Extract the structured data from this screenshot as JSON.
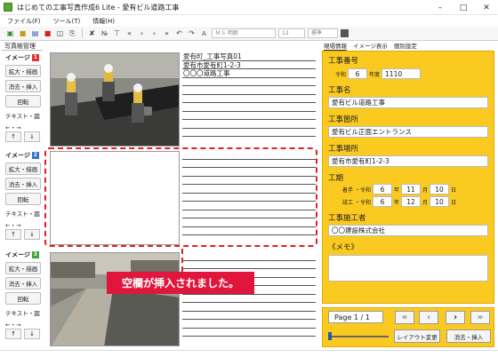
{
  "window": {
    "title": "はじめての工事写真作成6 Lite - 愛有ビル道路工事"
  },
  "menu": [
    "ファイル(F)",
    "ツール(T)",
    "情報(H)"
  ],
  "toolbar": {
    "font": "ＭＳ 明朝",
    "size": "12",
    "style": "標準"
  },
  "left": {
    "tab": "写真帳管理",
    "groups": [
      {
        "label": "イメージ",
        "num": "1",
        "badge": "#e03030"
      },
      {
        "label": "イメージ",
        "num": "2",
        "badge": "#2f74c8"
      },
      {
        "label": "イメージ",
        "num": "3",
        "badge": "#3aa33a"
      }
    ],
    "buttons": {
      "enlarge": "拡大・描画",
      "erase": "消去・挿入",
      "rotate": "回転",
      "text": "テキスト・図",
      "arrows": "←・→"
    }
  },
  "photos": [
    {
      "lines": [
        "愛有町_工事写真01",
        "愛有市愛有町1-2-3",
        "〇〇〇道路工事"
      ]
    },
    {
      "lines": []
    },
    {
      "lines": []
    }
  ],
  "notice": "空欄が挿入されました。",
  "right": {
    "tabs": [
      "現場情報",
      "イメージ表示",
      "個別設定"
    ],
    "work_no": {
      "label": "工事番号",
      "era": "令和",
      "year": "6",
      "year_unit": "年度",
      "code": "1110"
    },
    "work_name": {
      "label": "工事名",
      "value": "愛有ビル道路工事"
    },
    "work_place": {
      "label": "工事箇所",
      "value": "愛有ビル正面エントランス"
    },
    "work_site": {
      "label": "工事場所",
      "value": "愛有市愛有町1-2-3"
    },
    "period": {
      "label": "工期",
      "start": {
        "label": "着手",
        "era": "・令和",
        "y": "6",
        "m": "11",
        "d": "10"
      },
      "end": {
        "label": "竣工",
        "era": "・令和",
        "y": "6",
        "m": "12",
        "d": "10"
      },
      "units": {
        "y": "年",
        "m": "月",
        "d": "日"
      }
    },
    "contractor": {
      "label": "工事施工者",
      "value": "〇〇建設株式会社"
    },
    "memo": {
      "label": "《メモ》"
    }
  },
  "pager": {
    "page": "Page 1 / 1",
    "layout_btn": "レイアウト変更",
    "erase_btn": "消去・挿入"
  }
}
